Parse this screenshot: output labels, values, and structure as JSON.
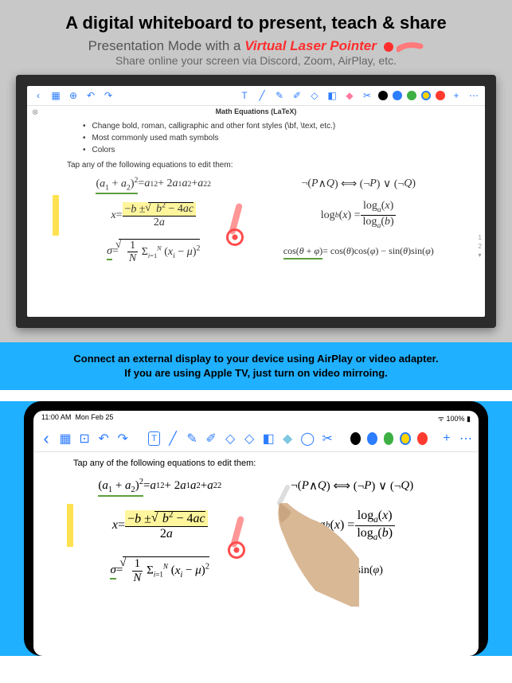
{
  "header": {
    "headline": "A digital whiteboard to present, teach & share",
    "subhead_prefix": "Presentation Mode with a ",
    "subhead_emphasis": "Virtual Laser Pointer",
    "subhead2": "Share online your screen via Discord, Zoom, AirPlay, etc."
  },
  "display": {
    "doc_title": "Math Equations (LaTeX)",
    "bullets": [
      "Change bold, roman, calligraphic and other font styles (\\bf, \\text, etc.)",
      "Most commonly used math symbols",
      "Colors"
    ],
    "tap_text": "Tap any of the following equations to edit them:",
    "equations": {
      "eq1_left": "(a₁ + a₂)² = a₁² + 2a₁a₂ + a₂²",
      "eq1_right": "¬(P ∧ Q) ⟺ (¬P) ∨ (¬Q)",
      "eq2_left_lhs": "x = ",
      "eq2_left_num": "−b ± √(b² − 4ac)",
      "eq2_left_den": "2a",
      "eq2_right_lhs": "logᵦ(x) = ",
      "eq2_right_num": "logₐ(x)",
      "eq2_right_den": "logₐ(b)",
      "eq3_left": "σ = √(1/N Σᵢ₌₁ᴺ (xᵢ − μ)²)",
      "eq3_right": "cos(θ + φ) = cos(θ)cos(φ) − sin(θ)sin(φ)"
    },
    "page_nums": [
      "1",
      "2"
    ]
  },
  "mid_banner": {
    "line1": "Connect an external display to your device using AirPlay or video adapter.",
    "line2": "If you are using Apple TV, just turn on video mirroing."
  },
  "ipad": {
    "status_time": "11:00 AM",
    "status_date": "Mon Feb 25",
    "status_battery": "100%",
    "tap_text": "Tap any of the following equations to edit them:"
  },
  "colors": {
    "black": "#000000",
    "blue": "#2d7dff",
    "green": "#3cb043",
    "yellow": "#ffd400",
    "red": "#ff3b30"
  },
  "toolbar_icons": [
    "back",
    "grid",
    "add-page",
    "undo",
    "redo",
    "text",
    "line",
    "pencil",
    "pen",
    "highlighter",
    "marker",
    "eraser",
    "eraser-fill",
    "lasso",
    "scissors"
  ]
}
